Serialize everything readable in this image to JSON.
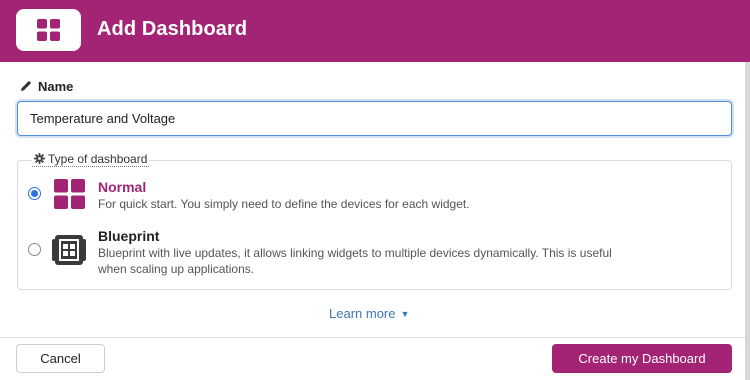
{
  "header": {
    "title": "Add Dashboard",
    "icon": "dashboard-grid-icon",
    "bg_color": "#a32475"
  },
  "name_field": {
    "label": "Name",
    "label_icon": "pencil-icon",
    "value": "Temperature and Voltage"
  },
  "type_section": {
    "legend": "Type of dashboard",
    "legend_icon": "gear-icon",
    "options": [
      {
        "title": "Normal",
        "description": "For quick start. You simply need to define the devices for each widget.",
        "icon": "normal-dashboard-icon",
        "selected": true
      },
      {
        "title": "Blueprint",
        "description_line1": "Blueprint with live updates, it allows linking widgets to multiple devices dynamically. This is useful",
        "description_line2": "when scaling up applications.",
        "icon": "blueprint-icon",
        "selected": false
      }
    ]
  },
  "learn_more": "Learn more",
  "footer": {
    "cancel_label": "Cancel",
    "create_label": "Create my Dashboard"
  },
  "colors": {
    "accent": "#a32475",
    "link": "#3c78b8",
    "radio": "#2a72d9"
  }
}
